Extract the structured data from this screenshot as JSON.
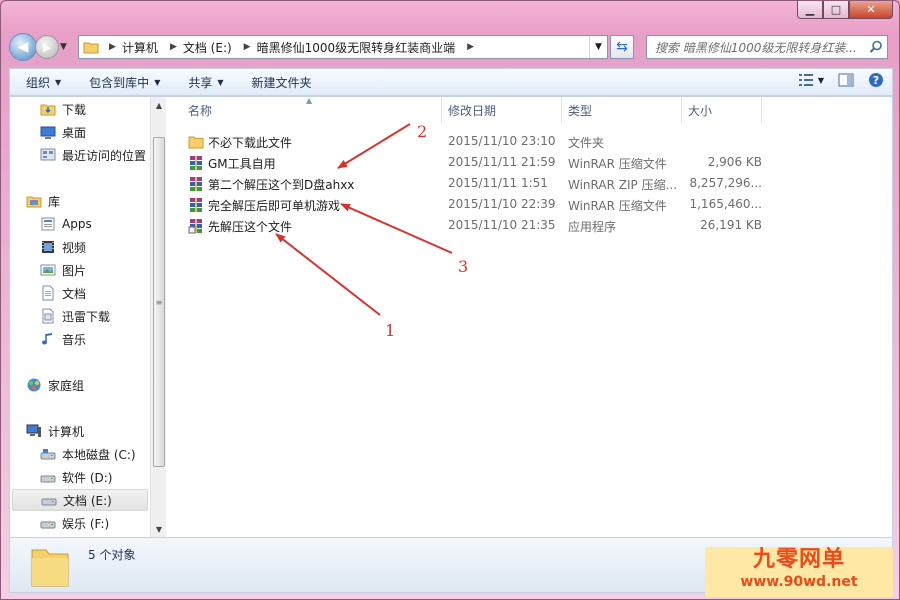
{
  "window": {
    "caption": {
      "minimize": "▁",
      "maximize": "□",
      "close": "✕"
    }
  },
  "address": {
    "segments": [
      "计算机",
      "文档 (E:)",
      "暗黑修仙1000级无限转身红装商业端"
    ],
    "search_placeholder": "搜索 暗黑修仙1000级无限转身红装..."
  },
  "toolbar": {
    "organize": "组织",
    "include_in_library": "包含到库中",
    "share": "共享",
    "new_folder": "新建文件夹"
  },
  "sidebar": {
    "favorites": [
      {
        "label": "下载",
        "icon": "download-folder-icon"
      },
      {
        "label": "桌面",
        "icon": "desktop-icon"
      },
      {
        "label": "最近访问的位置",
        "icon": "recent-places-icon"
      }
    ],
    "libraries_label": "库",
    "libraries": [
      {
        "label": "Apps",
        "icon": "apps-icon"
      },
      {
        "label": "视频",
        "icon": "video-icon"
      },
      {
        "label": "图片",
        "icon": "pictures-icon"
      },
      {
        "label": "文档",
        "icon": "documents-icon"
      },
      {
        "label": "迅雷下载",
        "icon": "thunder-download-icon"
      },
      {
        "label": "音乐",
        "icon": "music-icon"
      }
    ],
    "homegroup_label": "家庭组",
    "computer_label": "计算机",
    "drives": [
      {
        "label": "本地磁盘 (C:)",
        "icon": "system-drive-icon"
      },
      {
        "label": "软件 (D:)",
        "icon": "drive-icon"
      },
      {
        "label": "文档 (E:)",
        "icon": "drive-icon",
        "selected": true
      },
      {
        "label": "娱乐 (F:)",
        "icon": "drive-icon"
      }
    ]
  },
  "columns": {
    "name": "名称",
    "date": "修改日期",
    "type": "类型",
    "size": "大小"
  },
  "files": [
    {
      "name": "不必下载此文件",
      "date": "2015/11/10 23:10",
      "type": "文件夹",
      "size": "",
      "icon": "folder-icon"
    },
    {
      "name": "GM工具自用",
      "date": "2015/11/11 21:59",
      "type": "WinRAR 压缩文件",
      "size": "2,906 KB",
      "icon": "winrar-archive-icon"
    },
    {
      "name": "第二个解压这个到D盘ahxx",
      "date": "2015/11/11 1:51",
      "type": "WinRAR ZIP 压缩...",
      "size": "8,257,296...",
      "icon": "winrar-archive-icon"
    },
    {
      "name": "完全解压后即可单机游戏",
      "date": "2015/11/10 22:39",
      "type": "WinRAR 压缩文件",
      "size": "1,165,460...",
      "icon": "winrar-archive-icon"
    },
    {
      "name": "先解压这个文件",
      "date": "2015/11/10 21:35",
      "type": "应用程序",
      "size": "26,191 KB",
      "icon": "winrar-sfx-icon"
    }
  ],
  "status": {
    "count": "5 个对象"
  },
  "annotations": [
    "2",
    "3",
    "1"
  ],
  "watermark": {
    "title": "九零网单",
    "url": "www.90wd.net"
  },
  "colors": {
    "frame": "#e6a1c8",
    "arrow": "#d9322b",
    "selection": "#e3e3e3",
    "watermark_bg": "#ffe8a6",
    "watermark_text": "#e84c1a"
  }
}
